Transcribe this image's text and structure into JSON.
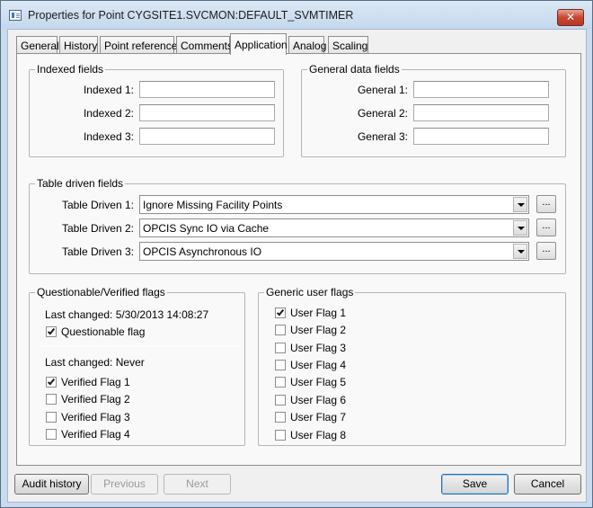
{
  "window": {
    "title": "Properties for Point CYGSITE1.SVCMON:DEFAULT_SVMTIMER",
    "close_glyph": "✕"
  },
  "tabs": [
    {
      "label": "General"
    },
    {
      "label": "History"
    },
    {
      "label": "Point reference"
    },
    {
      "label": "Comments"
    },
    {
      "label": "Application",
      "active": true
    },
    {
      "label": "Analog"
    },
    {
      "label": "Scaling"
    }
  ],
  "indexed": {
    "title": "Indexed fields",
    "fields": [
      {
        "label": "Indexed 1:",
        "value": ""
      },
      {
        "label": "Indexed 2:",
        "value": ""
      },
      {
        "label": "Indexed 3:",
        "value": ""
      }
    ]
  },
  "general_data": {
    "title": "General data fields",
    "fields": [
      {
        "label": "General 1:",
        "value": ""
      },
      {
        "label": "General 2:",
        "value": ""
      },
      {
        "label": "General 3:",
        "value": ""
      }
    ]
  },
  "table_driven": {
    "title": "Table driven fields",
    "ellipsis_label": "...",
    "rows": [
      {
        "label": "Table Driven 1:",
        "value": "Ignore Missing Facility Points"
      },
      {
        "label": "Table Driven 2:",
        "value": "OPCIS Sync IO via Cache"
      },
      {
        "label": "Table Driven 3:",
        "value": "OPCIS Asynchronous IO"
      }
    ]
  },
  "qv_flags": {
    "title": "Questionable/Verified flags",
    "questionable_last_changed": "Last changed: 5/30/2013 14:08:27",
    "questionable_label": "Questionable flag",
    "questionable_checked": true,
    "verified_last_changed": "Last changed: Never",
    "verified": [
      {
        "label": "Verified Flag 1",
        "checked": true
      },
      {
        "label": "Verified Flag 2",
        "checked": false
      },
      {
        "label": "Verified Flag 3",
        "checked": false
      },
      {
        "label": "Verified Flag 4",
        "checked": false
      }
    ]
  },
  "user_flags": {
    "title": "Generic user flags",
    "flags": [
      {
        "label": "User Flag 1",
        "checked": true
      },
      {
        "label": "User Flag 2",
        "checked": false
      },
      {
        "label": "User Flag 3",
        "checked": false
      },
      {
        "label": "User Flag 4",
        "checked": false
      },
      {
        "label": "User Flag 5",
        "checked": false
      },
      {
        "label": "User Flag 6",
        "checked": false
      },
      {
        "label": "User Flag 7",
        "checked": false
      },
      {
        "label": "User Flag 8",
        "checked": false
      }
    ]
  },
  "buttons": {
    "audit_history": "Audit history",
    "previous": "Previous",
    "next": "Next",
    "save": "Save",
    "cancel": "Cancel"
  }
}
